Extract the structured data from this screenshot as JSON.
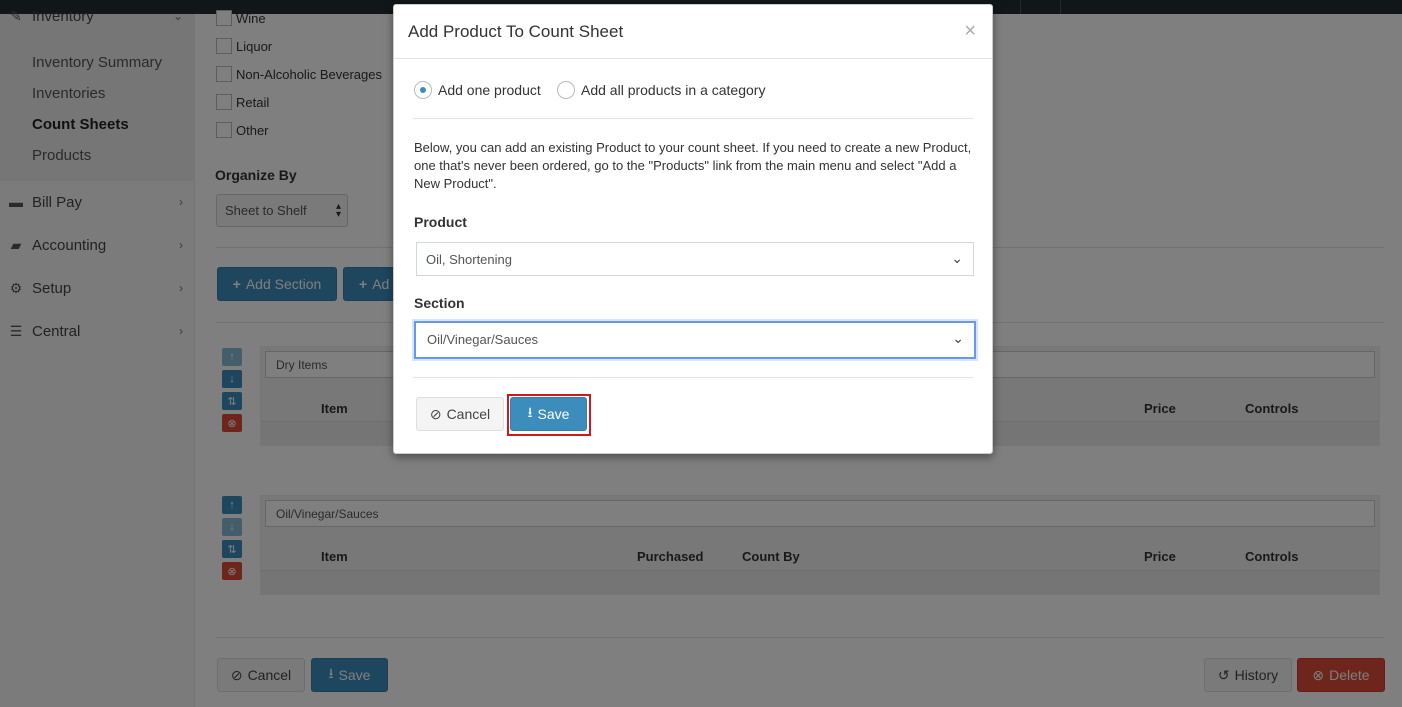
{
  "sidebar": {
    "inventory_label": "Inventory",
    "sub_items": [
      "Inventory Summary",
      "Inventories",
      "Count Sheets",
      "Products"
    ],
    "active_sub": "Count Sheets",
    "items": [
      {
        "label": "Bill Pay",
        "icon": "money-icon"
      },
      {
        "label": "Accounting",
        "icon": "briefcase-icon"
      },
      {
        "label": "Setup",
        "icon": "gear-icon"
      },
      {
        "label": "Central",
        "icon": "database-icon"
      }
    ]
  },
  "main": {
    "categories": [
      "Wine",
      "Liquor",
      "Non-Alcoholic Beverages",
      "Retail",
      "Other"
    ],
    "organize_by_label": "Organize By",
    "organize_by_value": "Sheet to Shelf",
    "add_section_label": "Add Section",
    "add_product_label": "Ad",
    "sections": [
      {
        "name": "Dry Items",
        "columns": [
          "Item",
          "Price",
          "Controls"
        ]
      },
      {
        "name": "Oil/Vinegar/Sauces",
        "columns": [
          "Item",
          "Purchased",
          "Count By",
          "Price",
          "Controls"
        ]
      }
    ],
    "footer": {
      "cancel_label": "Cancel",
      "save_label": "Save",
      "history_label": "History",
      "delete_label": "Delete"
    }
  },
  "modal": {
    "title": "Add Product To Count Sheet",
    "close_glyph": "×",
    "radio_one": "Add one product",
    "radio_all": "Add all products in a category",
    "selected_radio": "one",
    "help_text": "Below, you can add an existing Product to your count sheet. If you need to create a new Product, one that's never been ordered, go to the \"Products\" link from the main menu and select \"Add a New Product\".",
    "product_label": "Product",
    "product_value": "Oil, Shortening",
    "section_label": "Section",
    "section_value": "Oil/Vinegar/Sauces",
    "cancel_label": "Cancel",
    "save_label": "Save"
  },
  "colors": {
    "primary": "#3c8dbc",
    "danger": "#dd4b39",
    "highlight": "#d0181c"
  }
}
